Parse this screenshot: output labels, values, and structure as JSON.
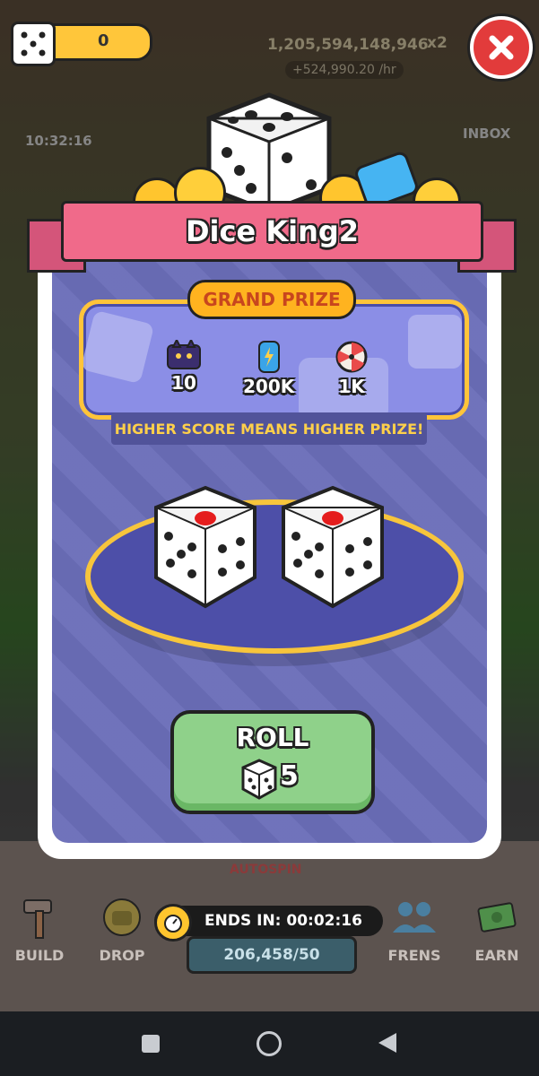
{
  "topbar": {
    "dice_count": "0",
    "coin_balance": "1,205,594,148,946",
    "income_rate": "+524,990.20 /hr",
    "multiplier": "x2"
  },
  "background": {
    "timer": "10:32:16",
    "inbox_label": "INBOX"
  },
  "modal": {
    "title": "Dice King2",
    "grand_prize_label": "GRAND PRIZE",
    "prizes": [
      {
        "icon": "cat-card-icon",
        "value": "10"
      },
      {
        "icon": "energy-can-icon",
        "value": "200K"
      },
      {
        "icon": "prize-wheel-icon",
        "value": "1K"
      }
    ],
    "hint": "HIGHER SCORE MEANS HIGHER PRIZE!",
    "roll_label": "ROLL",
    "roll_count": "5"
  },
  "timer_pill": {
    "label": "ENDS IN: 00:02:16"
  },
  "bottom_nav": {
    "items": [
      {
        "label": "BUILD",
        "icon": "hammer-icon"
      },
      {
        "label": "DROP",
        "icon": "cat-badge-icon"
      },
      {
        "label": "FRENS",
        "icon": "friends-icon"
      },
      {
        "label": "EARN",
        "icon": "cash-icon"
      }
    ],
    "autospin_label": "AUTOSPIN",
    "spin_count": "206,458/50"
  },
  "colors": {
    "ribbon": "#f06a8a",
    "panel": "#6a6db8",
    "gold": "#ffc43a",
    "roll_button": "#8fd18a",
    "close": "#e23b3b"
  }
}
